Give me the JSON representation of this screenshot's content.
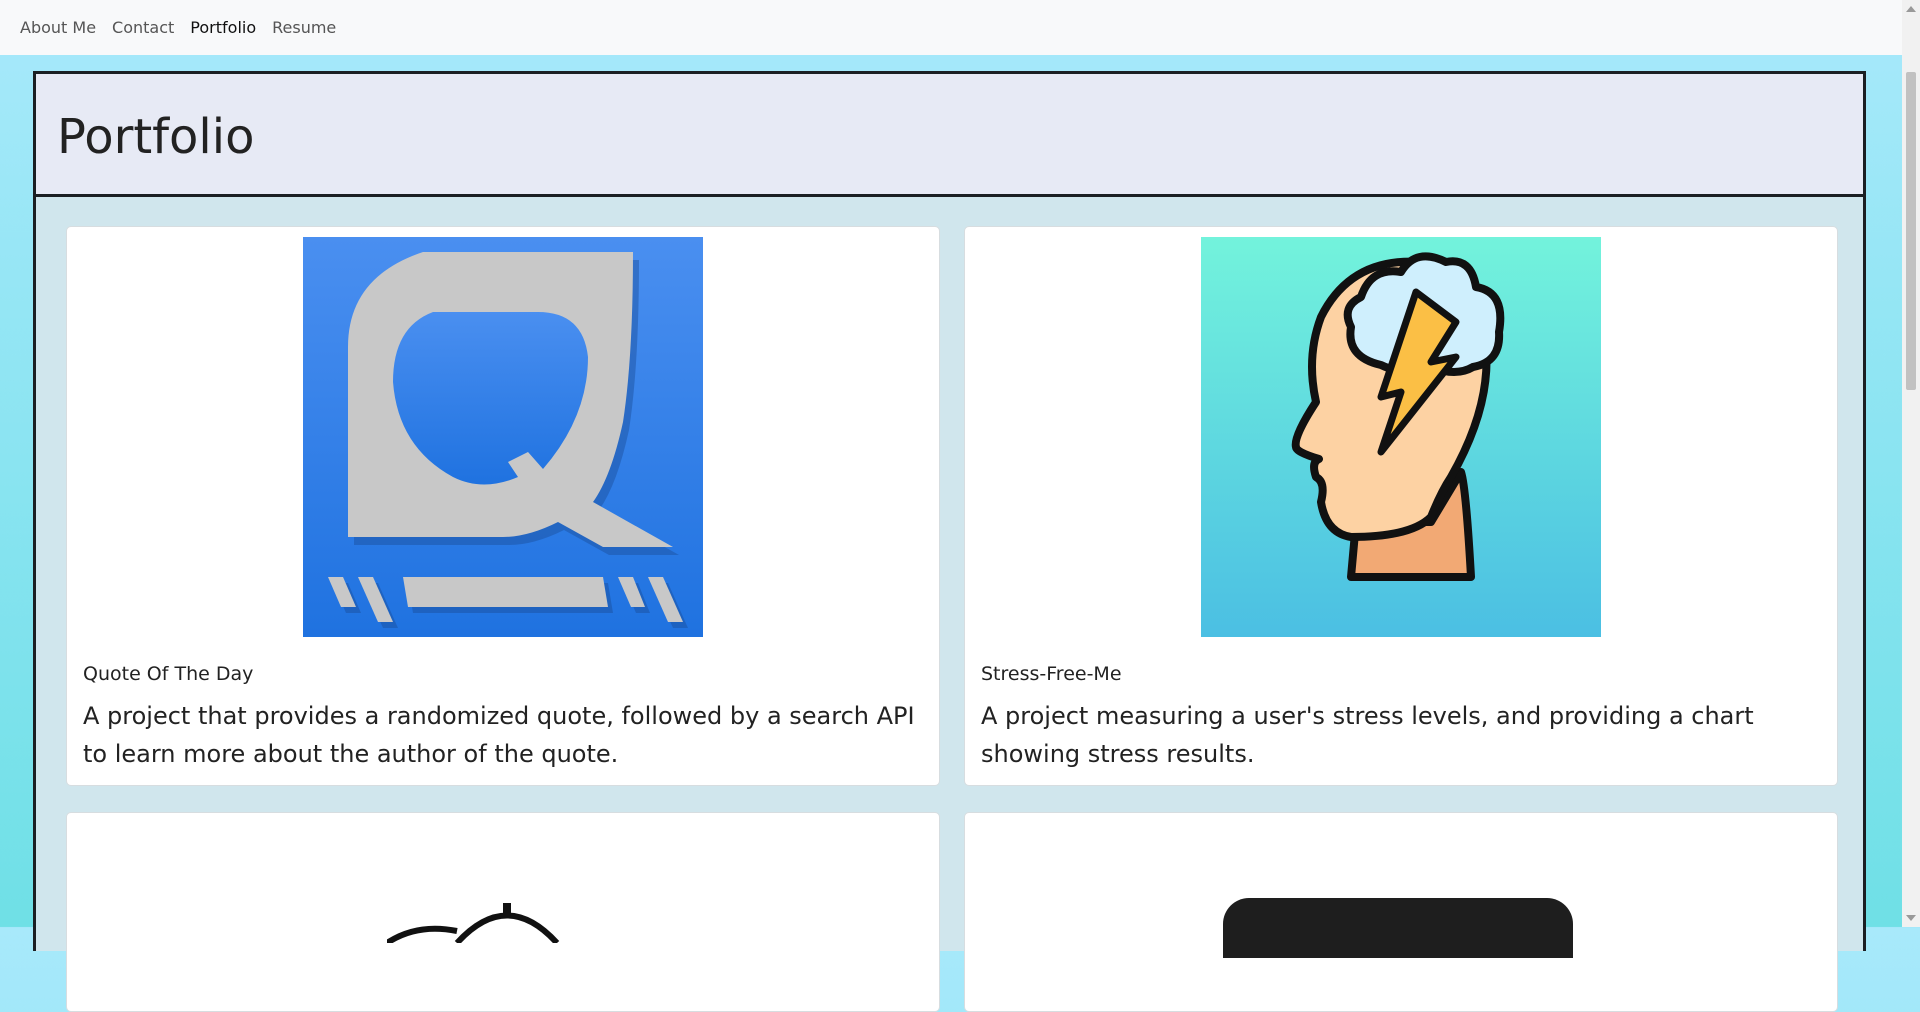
{
  "nav": {
    "items": [
      {
        "label": "About Me",
        "active": false
      },
      {
        "label": "Contact",
        "active": false
      },
      {
        "label": "Portfolio",
        "active": true
      },
      {
        "label": "Resume",
        "active": false
      }
    ]
  },
  "page": {
    "title": "Portfolio"
  },
  "projects": [
    {
      "title": "Quote Of The Day",
      "description": "A project that provides a randomized quote, followed by a search API to learn more about the author of the quote.",
      "image_icon": "q-logo-icon"
    },
    {
      "title": "Stress-Free-Me",
      "description": "A project measuring a user's stress levels, and providing a chart showing stress results.",
      "image_icon": "stressed-head-icon"
    },
    {
      "title": "",
      "description": "",
      "image_icon": "stopwatch-icon"
    },
    {
      "title": "",
      "description": "",
      "image_icon": "dark-rounded-icon"
    }
  ],
  "colors": {
    "q_logo_blue": "#2f7fe6",
    "stress_bg_top": "#73f3dc",
    "stress_bg_bottom": "#4bbfe3"
  }
}
